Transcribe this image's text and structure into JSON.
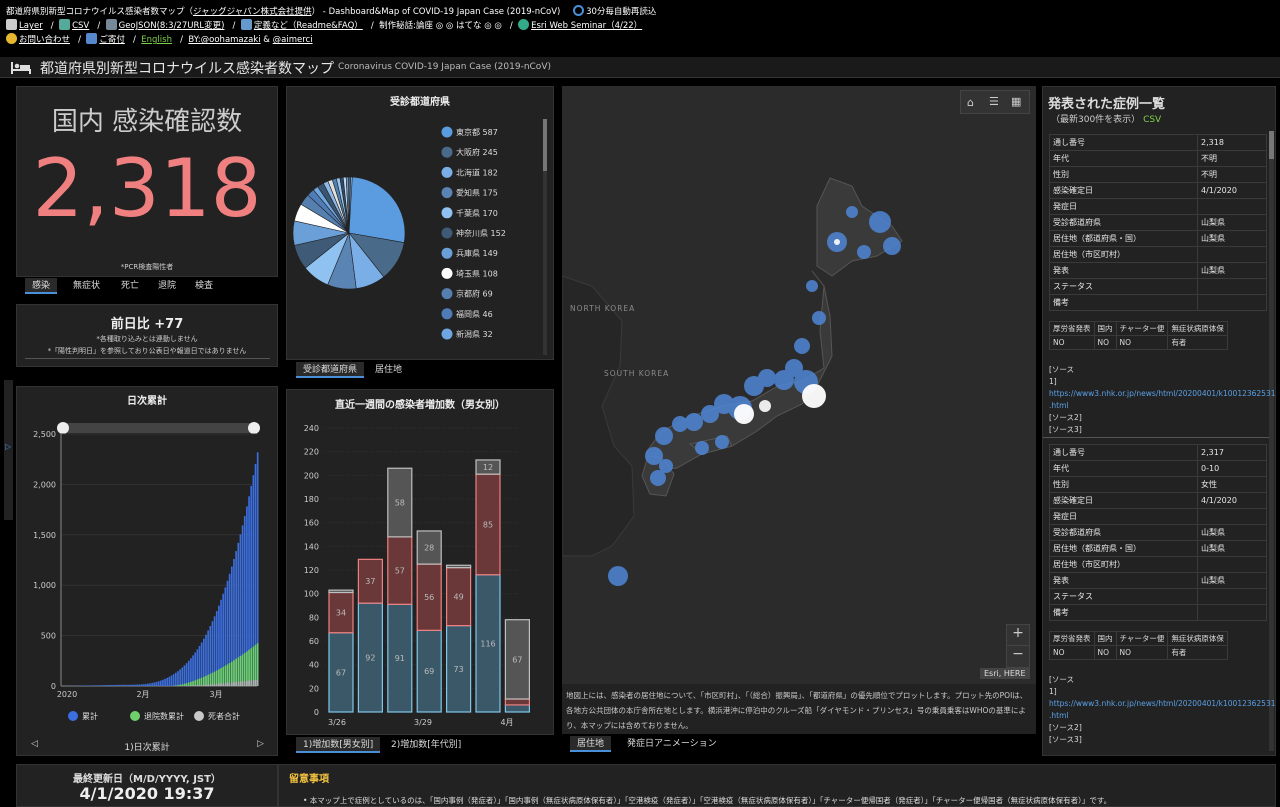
{
  "topbar": {
    "title": "都道府県別新型コロナウイルス感染者数マップ（",
    "title_link": "ジャッグジャパン株式会社提供",
    "title_rest": "） - Dashboard&Map of COVID-19 Japan Case (2019-nCoV)",
    "reload": "30分毎自動再読込",
    "links": [
      "Layer",
      "CSV",
      "GeoJSON(8:3/27URL変更)",
      "定義など（Readme&FAQ）",
      "Esri Web Seminar（4/22）"
    ],
    "credit_prefix": "制作秘話:論座",
    "credit_rest": "はてな",
    "row3": [
      "お問い合わせ",
      "ご寄付",
      "English",
      "BY:@oohamazaki",
      "&",
      "@aimerci"
    ]
  },
  "header": {
    "title": "都道府県別新型コロナウイルス感染者数マップ",
    "subtitle": "Coronavirus COVID-19 Japan Case (2019-nCoV)"
  },
  "total": {
    "title": "国内 感染確認数",
    "value": "2,318",
    "note": "*PCR検査陽性者"
  },
  "total_tabs": [
    "感染",
    "無症状",
    "死亡",
    "退院",
    "検査"
  ],
  "daily_diff": {
    "title": "前日比 +77",
    "note1": "*各種取り込みとは連動しません",
    "note2": "*「陽性判明日」を参照しており公表日や報道日ではありません"
  },
  "cumulative": {
    "title": "日次累計",
    "footer": "1)日次累計"
  },
  "prefs": {
    "title": "受診都道府県",
    "tabs": [
      "受診都道府県",
      "居住地"
    ]
  },
  "weekly": {
    "title": "直近一週間の感染者増加数（男女別）",
    "tabs": [
      "1)増加数[男女別]",
      "2)増加数[年代別]"
    ]
  },
  "map": {
    "labels": [
      "NORTH KOREA",
      "SOUTH KOREA"
    ],
    "attribution": "Esri, HERE",
    "zoom_in": "+",
    "zoom_out": "−",
    "description": "地図上には、感染者の居住地について、「市区町村」、「（総合）振興局」、「都道府県」の優先順位でプロットします。プロット先のPOIは、各地方公共団体の本庁舎所在地とします。横浜港沖に停泊中のクルーズ船「ダイヤモンド・プリンセス」号の乗員乗客はWHOの基準により、本マップには含めておりません。",
    "tabs": [
      "居住地",
      "発症日アニメーション"
    ]
  },
  "cases": {
    "title": "発表された症例一覧",
    "subtitle": "（最新300件を表示）",
    "csv": "CSV",
    "records": [
      {
        "rows": [
          [
            "通し番号",
            "2,318"
          ],
          [
            "年代",
            "不明"
          ],
          [
            "性別",
            "不明"
          ],
          [
            "感染確定日",
            "4/1/2020"
          ],
          [
            "発症日",
            ""
          ],
          [
            "受診都道府県",
            "山梨県"
          ],
          [
            "居住地（都道府県・国）",
            "山梨県"
          ],
          [
            "居住地（市区町村）",
            ""
          ],
          [
            "発表",
            "山梨県"
          ],
          [
            "ステータス",
            ""
          ],
          [
            "備考",
            ""
          ]
        ],
        "flags_h": [
          "厚労省発表",
          "国内",
          "チャーター便",
          "無症状病原体保"
        ],
        "flags_v": [
          "NO",
          "NO",
          "NO",
          "有者"
        ],
        "src": "[ソース",
        "src1": "1]",
        "url": "https://www3.nhk.or.jp/news/html/20200401/k10012362531000",
        "url2": ".html",
        "src2": "[ソース2]",
        "src3": "[ソース3]"
      },
      {
        "rows": [
          [
            "通し番号",
            "2,317"
          ],
          [
            "年代",
            "0-10"
          ],
          [
            "性別",
            "女性"
          ],
          [
            "感染確定日",
            "4/1/2020"
          ],
          [
            "発症日",
            ""
          ],
          [
            "受診都道府県",
            "山梨県"
          ],
          [
            "居住地（都道府県・国）",
            "山梨県"
          ],
          [
            "居住地（市区町村）",
            ""
          ],
          [
            "発表",
            "山梨県"
          ],
          [
            "ステータス",
            ""
          ],
          [
            "備考",
            ""
          ]
        ],
        "flags_h": [
          "厚労省発表",
          "国内",
          "チャーター便",
          "無症状病原体保"
        ],
        "flags_v": [
          "NO",
          "NO",
          "NO",
          "有者"
        ],
        "src": "[ソース",
        "src1": "1]",
        "url": "https://www3.nhk.or.jp/news/html/20200401/k10012362531000",
        "url2": ".html",
        "src2": "[ソース2]",
        "src3": "[ソース3]"
      }
    ]
  },
  "updated": {
    "label": "最終更新日（M/D/YYYY, JST）",
    "value": "4/1/2020 19:37"
  },
  "notice": {
    "title": "留意事項",
    "text": "• 本マップ上で症例としているのは、「国内事例（発症者）」「国内事例（無症状病原体保有者）」「空港検疫（発症者）」「空港検疫（無症状病原体保有者）」「チャーター便帰国者（発症者）」「チャーター便帰国者（無症状病原体保有者）」です。"
  },
  "colors": {
    "accent": "#4a90d9",
    "total": "#f08080",
    "csv": "#7fd14a"
  },
  "chart_data": [
    {
      "type": "pie",
      "title": "受診都道府県",
      "categories": [
        "東京都",
        "大阪府",
        "北海道",
        "愛知県",
        "千葉県",
        "神奈川県",
        "兵庫県",
        "埼玉県",
        "京都府",
        "福岡県",
        "新潟県"
      ],
      "values": [
        587,
        245,
        182,
        175,
        170,
        152,
        149,
        108,
        69,
        46,
        32
      ],
      "colors": [
        "#5b9be0",
        "#4a6a8a",
        "#7aaee6",
        "#5a84b4",
        "#8fc2f0",
        "#3f5a76",
        "#6b9fd8",
        "#ffffff",
        "#557fae",
        "#4f7cb6",
        "#6ea6e0"
      ],
      "legend": "right"
    },
    {
      "type": "bar",
      "title": "日次累計",
      "x_ticks": [
        "2020",
        "2月",
        "3月"
      ],
      "ylim": [
        0,
        2500
      ],
      "y_ticks": [
        0,
        500,
        1000,
        1500,
        2000,
        2500
      ],
      "series": [
        {
          "name": "累計",
          "last": 2318
        },
        {
          "name": "退院数累計",
          "last": 424
        },
        {
          "name": "死者合計",
          "last": 63
        }
      ],
      "legend": "bottom"
    },
    {
      "type": "bar",
      "title": "直近一週間の感染者増加数（男女別）",
      "categories": [
        "3/26",
        "3/27",
        "3/28",
        "3/29",
        "3/30",
        "3/31",
        "4月"
      ],
      "x_ticks": [
        "3/26",
        "3/29",
        "4月"
      ],
      "ylim": [
        0,
        240
      ],
      "y_ticks": [
        0,
        20,
        40,
        60,
        80,
        100,
        120,
        140,
        160,
        180,
        200,
        220,
        240
      ],
      "series": [
        {
          "values": [
            67,
            92,
            91,
            69,
            73,
            116,
            6
          ]
        },
        {
          "values": [
            34,
            37,
            57,
            56,
            49,
            85,
            5
          ]
        },
        {
          "values": [
            2,
            0,
            58,
            28,
            2,
            12,
            67
          ]
        }
      ],
      "labels": [
        [
          "67",
          "34",
          ""
        ],
        [
          "92",
          "37",
          ""
        ],
        [
          "91",
          "57",
          "58"
        ],
        [
          "69",
          "56",
          "28"
        ],
        [
          "73",
          "49",
          ""
        ],
        [
          "116",
          "85",
          "12"
        ],
        [
          "",
          "",
          "67"
        ]
      ],
      "stacked": true
    }
  ]
}
